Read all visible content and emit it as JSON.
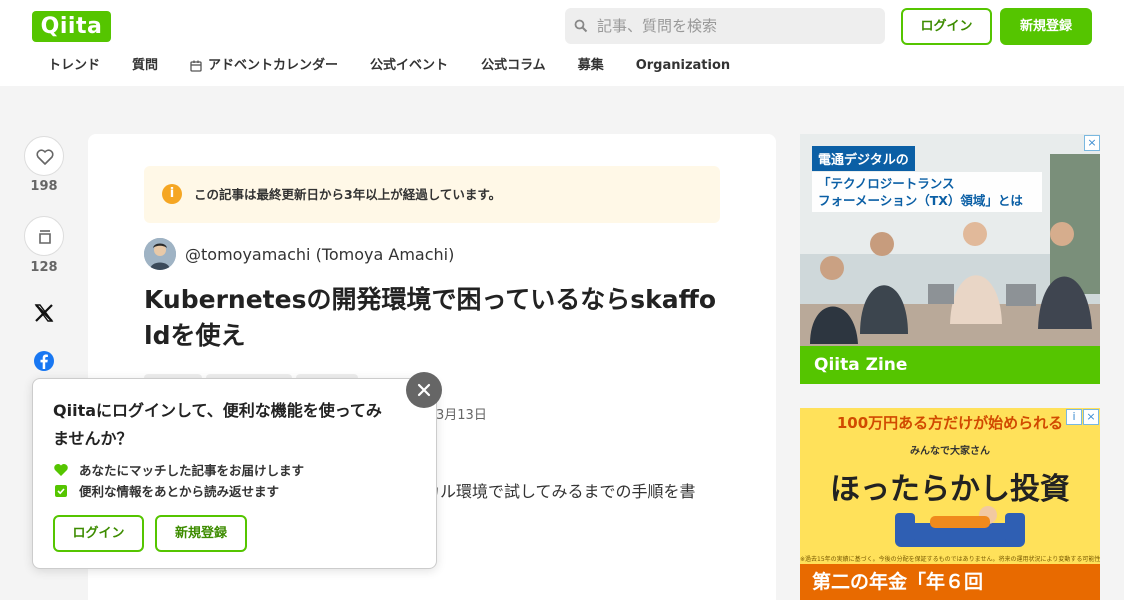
{
  "header": {
    "logo": "Qiita",
    "search_placeholder": "記事、質問を検索",
    "login_label": "ログイン",
    "signup_label": "新規登録"
  },
  "nav": {
    "items": [
      "トレンド",
      "質問",
      "アドベントカレンダー",
      "公式イベント",
      "公式コラム",
      "募集",
      "Organization"
    ]
  },
  "rail": {
    "like_count": "198",
    "stock_count": "128"
  },
  "article": {
    "notice": "この記事は最終更新日から3年以上が経過しています。",
    "author": "@tomoyamachi (Tomoya Amachi)",
    "title": "Kubernetesの開発環境で困っているならskaffoldを使え",
    "date_fragment": "3月13日",
    "body_fragment": "カル環境で試してみるまでの手順を書"
  },
  "popup": {
    "title": "Qiitaにログインして、便利な機能を使ってみませんか？",
    "features": [
      "あなたにマッチした記事をお届けします",
      "便利な情報をあとから読み返せます"
    ],
    "login_label": "ログイン",
    "signup_label": "新規登録"
  },
  "ad1": {
    "label": "電通デジタルの",
    "headline_1": "「テクノロジートランス",
    "headline_2": "フォーメーション（TX）領域」とは",
    "footer": "Qiita Zine"
  },
  "ad2": {
    "top": "100万円ある方だけが始められる",
    "brand": "みんなで大家さん",
    "main": "ほったらかし投資",
    "fine": "※過去15年の実績に基づく。今後の分配を保証するものではありません。将来の運用状況により変動する可能性があります。",
    "bottom": "第二の年金「年６回"
  },
  "colors": {
    "brand": "#55c500",
    "notice_bg": "#fff8e7",
    "notice_icon": "#f5a623",
    "twitter": "#000000",
    "facebook": "#1877f2"
  },
  "icons": [
    "search-icon",
    "calendar-icon",
    "heart-icon",
    "stock-icon",
    "x-logo-icon",
    "facebook-icon",
    "info-icon",
    "close-icon",
    "heart-check-icon",
    "check-icon"
  ]
}
